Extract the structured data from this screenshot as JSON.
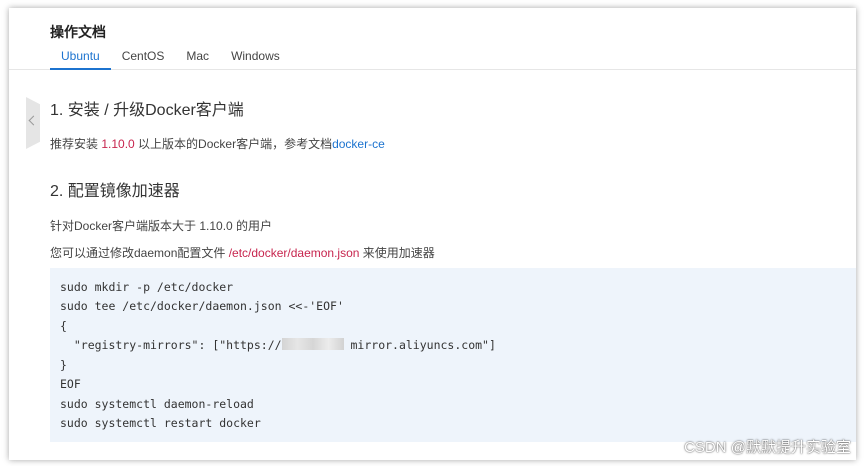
{
  "header": {
    "title": "操作文档",
    "tabs": [
      {
        "label": "Ubuntu",
        "active": true
      },
      {
        "label": "CentOS",
        "active": false
      },
      {
        "label": "Mac",
        "active": false
      },
      {
        "label": "Windows",
        "active": false
      }
    ]
  },
  "section1": {
    "heading": "1. 安装 / 升级Docker客户端",
    "text_prefix": "推荐安装 ",
    "version": "1.10.0",
    "text_mid": " 以上版本的Docker客户端，参考文档",
    "link_text": "docker-ce"
  },
  "section2": {
    "heading": "2. 配置镜像加速器",
    "line1": "针对Docker客户端版本大于 1.10.0 的用户",
    "line2_prefix": "您可以通过修改daemon配置文件 ",
    "config_path": "/etc/docker/daemon.json",
    "line2_suffix": " 来使用加速器"
  },
  "code": {
    "lines": [
      "sudo mkdir -p /etc/docker",
      "sudo tee /etc/docker/daemon.json <<-'EOF'",
      "{",
      "  \"registry-mirrors\": [\"https://",
      "}",
      "EOF",
      "sudo systemctl daemon-reload",
      "sudo systemctl restart docker"
    ],
    "mirror_suffix": "mirror.aliyuncs.com\"]"
  },
  "colors": {
    "accent": "#1c73cf",
    "highlight": "#c7254e",
    "code_bg": "#eef4fb"
  },
  "watermark": "CSDN @默默提升实验室"
}
